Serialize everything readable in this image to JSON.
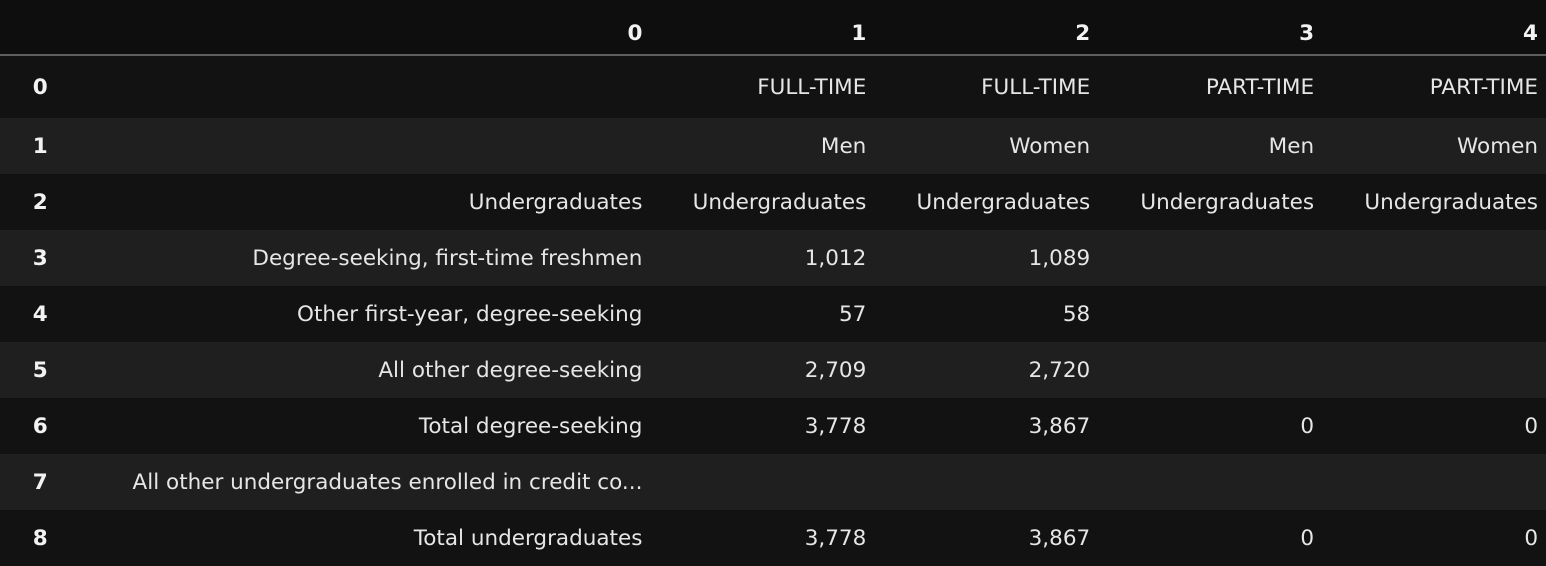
{
  "table": {
    "kind": "dataframe",
    "corner_label": "",
    "column_headers": [
      "0",
      "1",
      "2",
      "3",
      "4"
    ],
    "row_index_labels": [
      "0",
      "1",
      "2",
      "3",
      "4",
      "5",
      "6",
      "7",
      "8"
    ],
    "rows": [
      {
        "index": "0",
        "cells": [
          "",
          "FULL-TIME",
          "FULL-TIME",
          "PART-TIME",
          "PART-TIME"
        ]
      },
      {
        "index": "1",
        "cells": [
          "",
          "Men",
          "Women",
          "Men",
          "Women"
        ]
      },
      {
        "index": "2",
        "cells": [
          "Undergraduates",
          "Undergraduates",
          "Undergraduates",
          "Undergraduates",
          "Undergraduates"
        ]
      },
      {
        "index": "3",
        "cells": [
          "Degree-seeking, first-time freshmen",
          "1,012",
          "1,089",
          "",
          ""
        ]
      },
      {
        "index": "4",
        "cells": [
          "Other first-year, degree-seeking",
          "57",
          "58",
          "",
          ""
        ]
      },
      {
        "index": "5",
        "cells": [
          "All other degree-seeking",
          "2,709",
          "2,720",
          "",
          ""
        ]
      },
      {
        "index": "6",
        "cells": [
          "Total degree-seeking",
          "3,778",
          "3,867",
          "0",
          "0"
        ]
      },
      {
        "index": "7",
        "cells": [
          "All other undergraduates enrolled in credit co...",
          "",
          "",
          "",
          ""
        ]
      },
      {
        "index": "8",
        "cells": [
          "Total undergraduates",
          "3,778",
          "3,867",
          "0",
          "0"
        ]
      }
    ]
  },
  "theme": {
    "background": "#0e0e0e",
    "row_even": "#121212",
    "row_odd": "#1f1f1f",
    "text": "#e6e6e6",
    "header_text": "#f2f2f2",
    "rule": "#5e5e5e"
  }
}
